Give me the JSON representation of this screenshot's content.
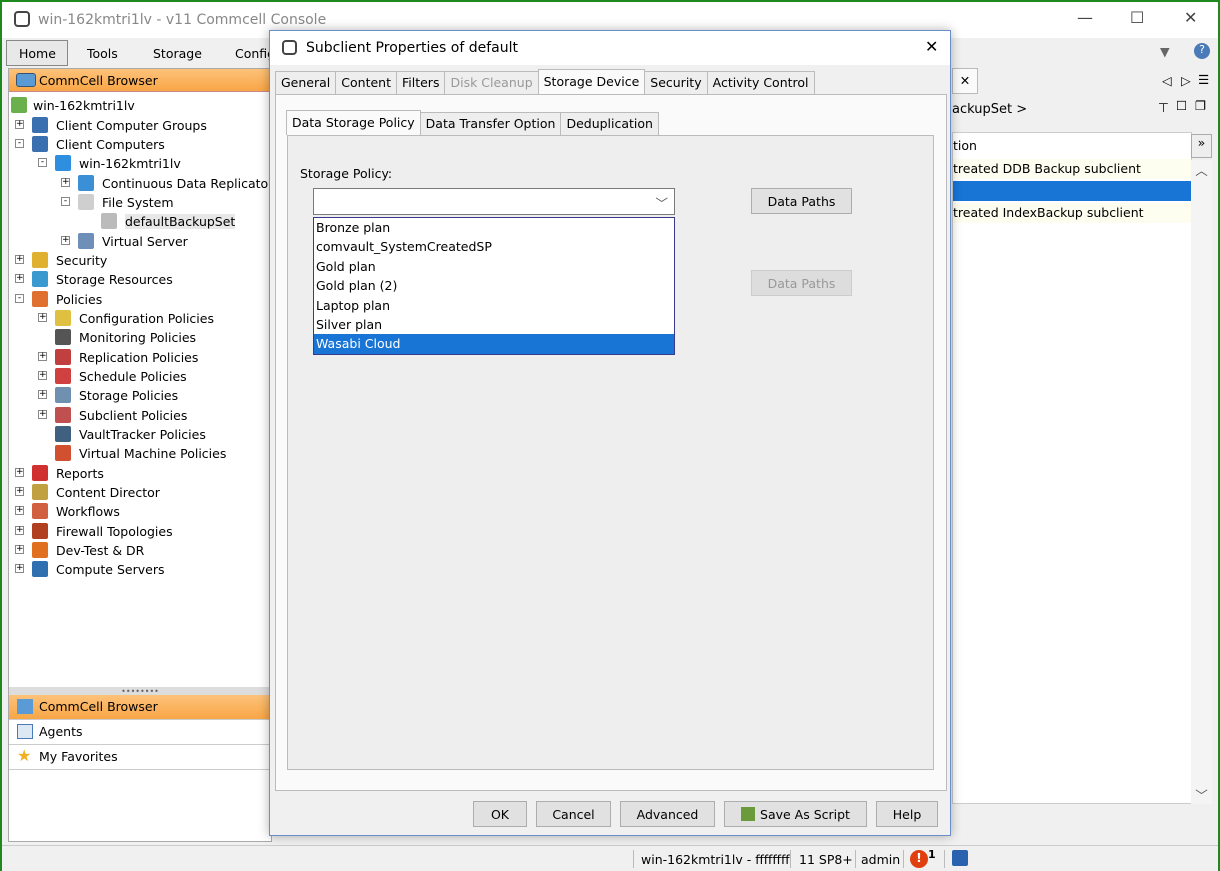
{
  "app": {
    "title": "win-162kmtri1lv - v11 Commcell Console"
  },
  "menu": [
    "Home",
    "Tools",
    "Storage",
    "Configi"
  ],
  "browser": {
    "header": "CommCell Browser",
    "tree": [
      {
        "label": "win-162kmtri1lv",
        "level": 0,
        "exp": "",
        "color": "#6ab04c"
      },
      {
        "label": "Client Computer Groups",
        "level": 1,
        "exp": "+",
        "color": "#3a6fb0"
      },
      {
        "label": "Client Computers",
        "level": 1,
        "exp": "-",
        "color": "#3a6fb0"
      },
      {
        "label": "win-162kmtri1lv",
        "level": 2,
        "exp": "-",
        "color": "#2e8fe0"
      },
      {
        "label": "Continuous Data Replicator",
        "level": 3,
        "exp": "+",
        "color": "#3b8fd6"
      },
      {
        "label": "File System",
        "level": 3,
        "exp": "-",
        "color": "#cfcfcf"
      },
      {
        "label": "defaultBackupSet",
        "level": 4,
        "exp": "",
        "color": "#bbbbbb",
        "selected": true
      },
      {
        "label": "Virtual Server",
        "level": 3,
        "exp": "+",
        "color": "#6e8fb8"
      },
      {
        "label": "Security",
        "level": 1,
        "exp": "+",
        "color": "#e0b030"
      },
      {
        "label": "Storage Resources",
        "level": 1,
        "exp": "+",
        "color": "#3a9ad0"
      },
      {
        "label": "Policies",
        "level": 1,
        "exp": "-",
        "color": "#e07030"
      },
      {
        "label": "Configuration Policies",
        "level": 2,
        "exp": "+",
        "color": "#e0c040"
      },
      {
        "label": "Monitoring Policies",
        "level": 2,
        "exp": "",
        "color": "#555555"
      },
      {
        "label": "Replication Policies",
        "level": 2,
        "exp": "+",
        "color": "#c04040"
      },
      {
        "label": "Schedule Policies",
        "level": 2,
        "exp": "+",
        "color": "#d04040"
      },
      {
        "label": "Storage Policies",
        "level": 2,
        "exp": "+",
        "color": "#7090b0"
      },
      {
        "label": "Subclient Policies",
        "level": 2,
        "exp": "+",
        "color": "#c05050"
      },
      {
        "label": "VaultTracker Policies",
        "level": 2,
        "exp": "",
        "color": "#406080"
      },
      {
        "label": "Virtual Machine Policies",
        "level": 2,
        "exp": "",
        "color": "#d05030"
      },
      {
        "label": "Reports",
        "level": 1,
        "exp": "+",
        "color": "#d03030"
      },
      {
        "label": "Content Director",
        "level": 1,
        "exp": "+",
        "color": "#c0a040"
      },
      {
        "label": "Workflows",
        "level": 1,
        "exp": "+",
        "color": "#d06040"
      },
      {
        "label": "Firewall Topologies",
        "level": 1,
        "exp": "+",
        "color": "#b04020"
      },
      {
        "label": "Dev-Test & DR",
        "level": 1,
        "exp": "+",
        "color": "#e07020"
      },
      {
        "label": "Compute Servers",
        "level": 1,
        "exp": "+",
        "color": "#3070b0"
      }
    ],
    "bottom": [
      "CommCell Browser",
      "Agents",
      "My Favorites"
    ]
  },
  "right": {
    "breadcrumb": "ackupSet  >",
    "column": "tion",
    "rows": [
      "treated DDB Backup subclient",
      "",
      "treated IndexBackup subclient"
    ]
  },
  "status": {
    "host": "win-162kmtri1lv - ffffffff",
    "version": "11 SP8+",
    "user": "admin",
    "alerts": "1"
  },
  "dialog": {
    "title": "Subclient Properties of default",
    "tabs": [
      "General",
      "Content",
      "Filters",
      "Disk Cleanup",
      "Storage Device",
      "Security",
      "Activity Control"
    ],
    "inner_tabs": [
      "Data Storage Policy",
      "Data Transfer Option",
      "Deduplication"
    ],
    "storage_policy_label": "Storage Policy:",
    "storage_policy_value": "",
    "options": [
      "Bronze plan",
      "comvault_SystemCreatedSP",
      "Gold plan",
      "Gold plan (2)",
      "Laptop plan",
      "Silver plan",
      "Wasabi Cloud"
    ],
    "highlighted": "Wasabi Cloud",
    "data_paths": "Data Paths",
    "buttons": {
      "ok": "OK",
      "cancel": "Cancel",
      "advanced": "Advanced",
      "save_script": "Save As Script",
      "help": "Help"
    }
  }
}
